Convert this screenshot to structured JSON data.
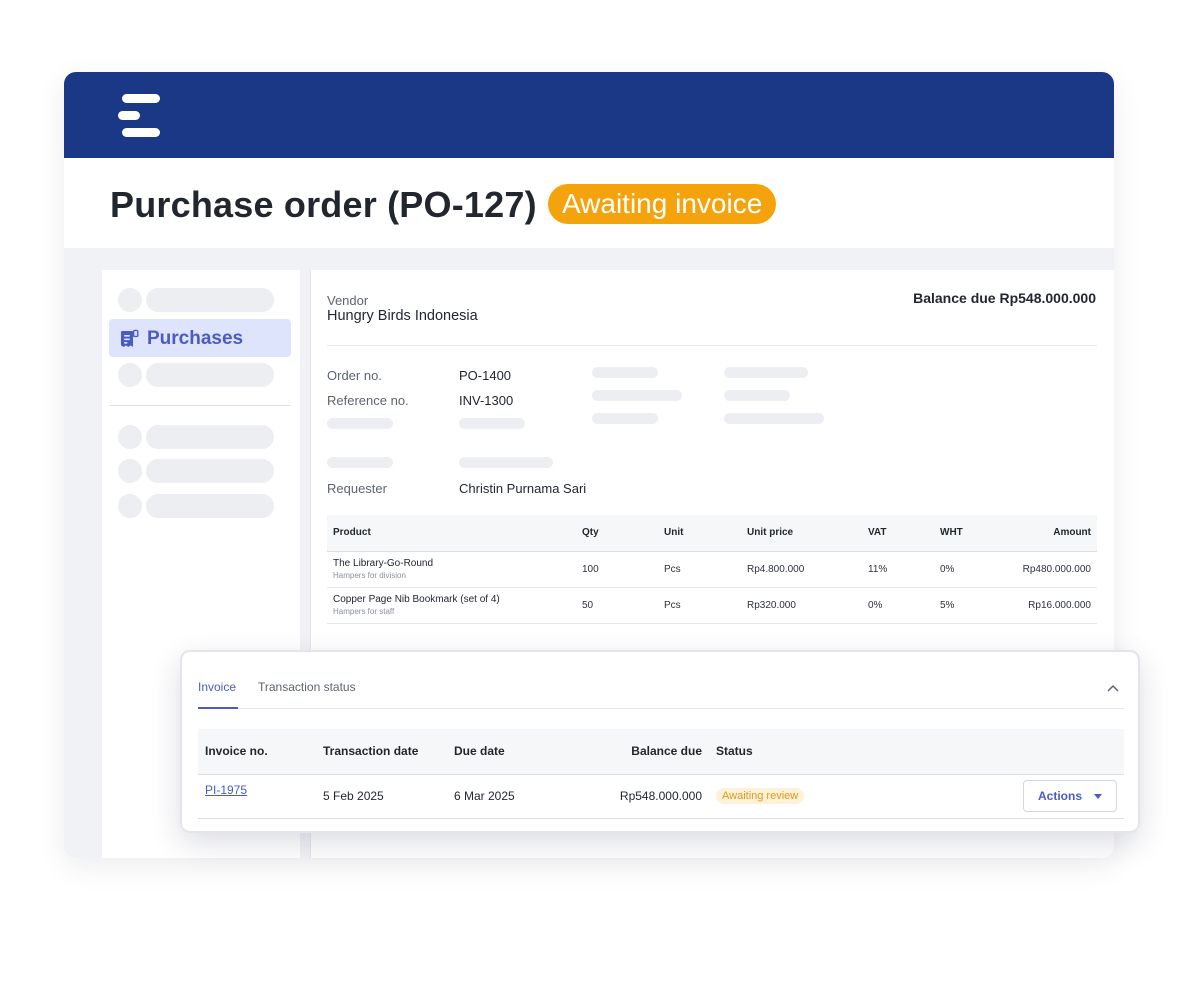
{
  "header": {
    "title": "Purchase order (PO-127)",
    "status_badge": "Awaiting invoice"
  },
  "sidebar": {
    "active_item": {
      "label": "Purchases",
      "icon": "receipt-icon"
    }
  },
  "order": {
    "vendor_label": "Vendor",
    "vendor_name": "Hungry Birds Indonesia",
    "balance_due": "Balance due Rp548.000.000",
    "order_no_label": "Order no.",
    "order_no": "PO-1400",
    "reference_no_label": "Reference no.",
    "reference_no": "INV-1300",
    "requester_label": "Requester",
    "requester": "Christin Purnama Sari"
  },
  "products": {
    "headers": {
      "product": "Product",
      "qty": "Qty",
      "unit": "Unit",
      "unit_price": "Unit price",
      "vat": "VAT",
      "wht": "WHT",
      "amount": "Amount"
    },
    "rows": [
      {
        "name": "The Library-Go-Round",
        "note": "Hampers for division",
        "qty": "100",
        "unit": "Pcs",
        "unit_price": "Rp4.800.000",
        "vat": "11%",
        "wht": "0%",
        "amount": "Rp480.000.000"
      },
      {
        "name": "Copper Page Nib Bookmark (set of 4)",
        "note": "Hampers for staff",
        "qty": "50",
        "unit": "Pcs",
        "unit_price": "Rp320.000",
        "vat": "0%",
        "wht": "5%",
        "amount": "Rp16.000.000"
      }
    ]
  },
  "invoice_panel": {
    "tabs": [
      "Invoice",
      "Transaction status"
    ],
    "active_tab": "Invoice",
    "headers": {
      "invoice_no": "Invoice no.",
      "transaction_date": "Transaction date",
      "due_date": "Due date",
      "balance_due": "Balance due",
      "status": "Status"
    },
    "rows": [
      {
        "invoice_no": "PI-1975",
        "transaction_date": "5 Feb 2025",
        "due_date": "6 Mar 2025",
        "balance_due": "Rp548.000.000",
        "status": "Awaiting review",
        "action_label": "Actions"
      }
    ]
  },
  "colors": {
    "brand_navy": "#1b3886",
    "badge_orange": "#f5a30c",
    "accent_blue": "#4a5cc4",
    "status_pill_bg": "#fdf1d8",
    "status_pill_text": "#d99a1e"
  }
}
